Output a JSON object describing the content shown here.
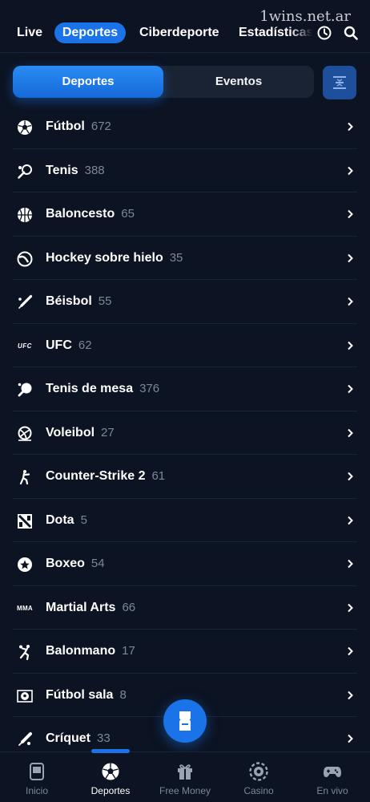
{
  "watermark": "1wins.net.ar",
  "topnav": {
    "tabs": [
      "Live",
      "Deportes",
      "Ciberdeporte",
      "Estadísticas"
    ],
    "active": "Deportes"
  },
  "segment": {
    "active_label": "Deportes",
    "inactive_label": "Eventos"
  },
  "sports": [
    {
      "name": "Fútbol",
      "count": "672",
      "icon": "soccer-ball-icon"
    },
    {
      "name": "Tenis",
      "count": "388",
      "icon": "tennis-racket-icon"
    },
    {
      "name": "Baloncesto",
      "count": "65",
      "icon": "basketball-icon"
    },
    {
      "name": "Hockey sobre hielo",
      "count": "35",
      "icon": "hockey-puck-icon"
    },
    {
      "name": "Béisbol",
      "count": "55",
      "icon": "baseball-bat-icon"
    },
    {
      "name": "UFC",
      "count": "62",
      "icon": "ufc-logo-icon",
      "icon_text": "UFC"
    },
    {
      "name": "Tenis de mesa",
      "count": "376",
      "icon": "ping-pong-icon"
    },
    {
      "name": "Voleibol",
      "count": "27",
      "icon": "volleyball-icon"
    },
    {
      "name": "Counter-Strike 2",
      "count": "61",
      "icon": "counter-strike-icon"
    },
    {
      "name": "Dota",
      "count": "5",
      "icon": "dota-logo-icon"
    },
    {
      "name": "Boxeo",
      "count": "54",
      "icon": "boxing-star-icon"
    },
    {
      "name": "Martial Arts",
      "count": "66",
      "icon": "mma-logo-icon",
      "icon_text": "MMA"
    },
    {
      "name": "Balonmano",
      "count": "17",
      "icon": "handball-icon"
    },
    {
      "name": "Fútbol sala",
      "count": "8",
      "icon": "futsal-icon"
    },
    {
      "name": "Críquet",
      "count": "33",
      "icon": "cricket-bat-icon"
    }
  ],
  "bottomnav": {
    "items": [
      {
        "label": "Inicio",
        "icon": "home-phone-icon"
      },
      {
        "label": "Deportes",
        "icon": "soccer-ball-icon",
        "active": true
      },
      {
        "label": "Free Money",
        "icon": "gift-icon"
      },
      {
        "label": "Casino",
        "icon": "casino-chip-icon"
      },
      {
        "label": "En vivo",
        "icon": "gamepad-icon"
      }
    ]
  },
  "colors": {
    "background": "#0c1322",
    "accent": "#1a73e8",
    "muted_text": "#7d8798",
    "divider": "#1a2438"
  }
}
